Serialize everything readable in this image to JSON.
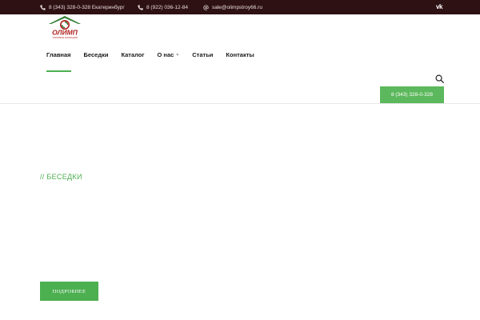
{
  "topbar": {
    "phone1": "8 (343) 328-0-328 Екатеринбург",
    "phone2": "8 (922) 036-12-84",
    "email": "sale@olimpstroy66.ru",
    "social": "vk-icon"
  },
  "logo": {
    "name": "ОЛИМП",
    "tagline": "ТОРГОВАЯ КОМПАНИЯ"
  },
  "nav": {
    "items": [
      "Главная",
      "Беседки",
      "Каталог",
      "О нас",
      "Статьи",
      "Контакты"
    ],
    "active": "Главная"
  },
  "header": {
    "phone_button": "8 (343) 328-0-328"
  },
  "main": {
    "section_title": "// БЕСЕДКИ",
    "more_button": "ПОДРОБНЕЕ"
  },
  "colors": {
    "topbar_bg": "#2e1113",
    "accent_green": "#4caf50",
    "logo_red": "#b22222"
  }
}
